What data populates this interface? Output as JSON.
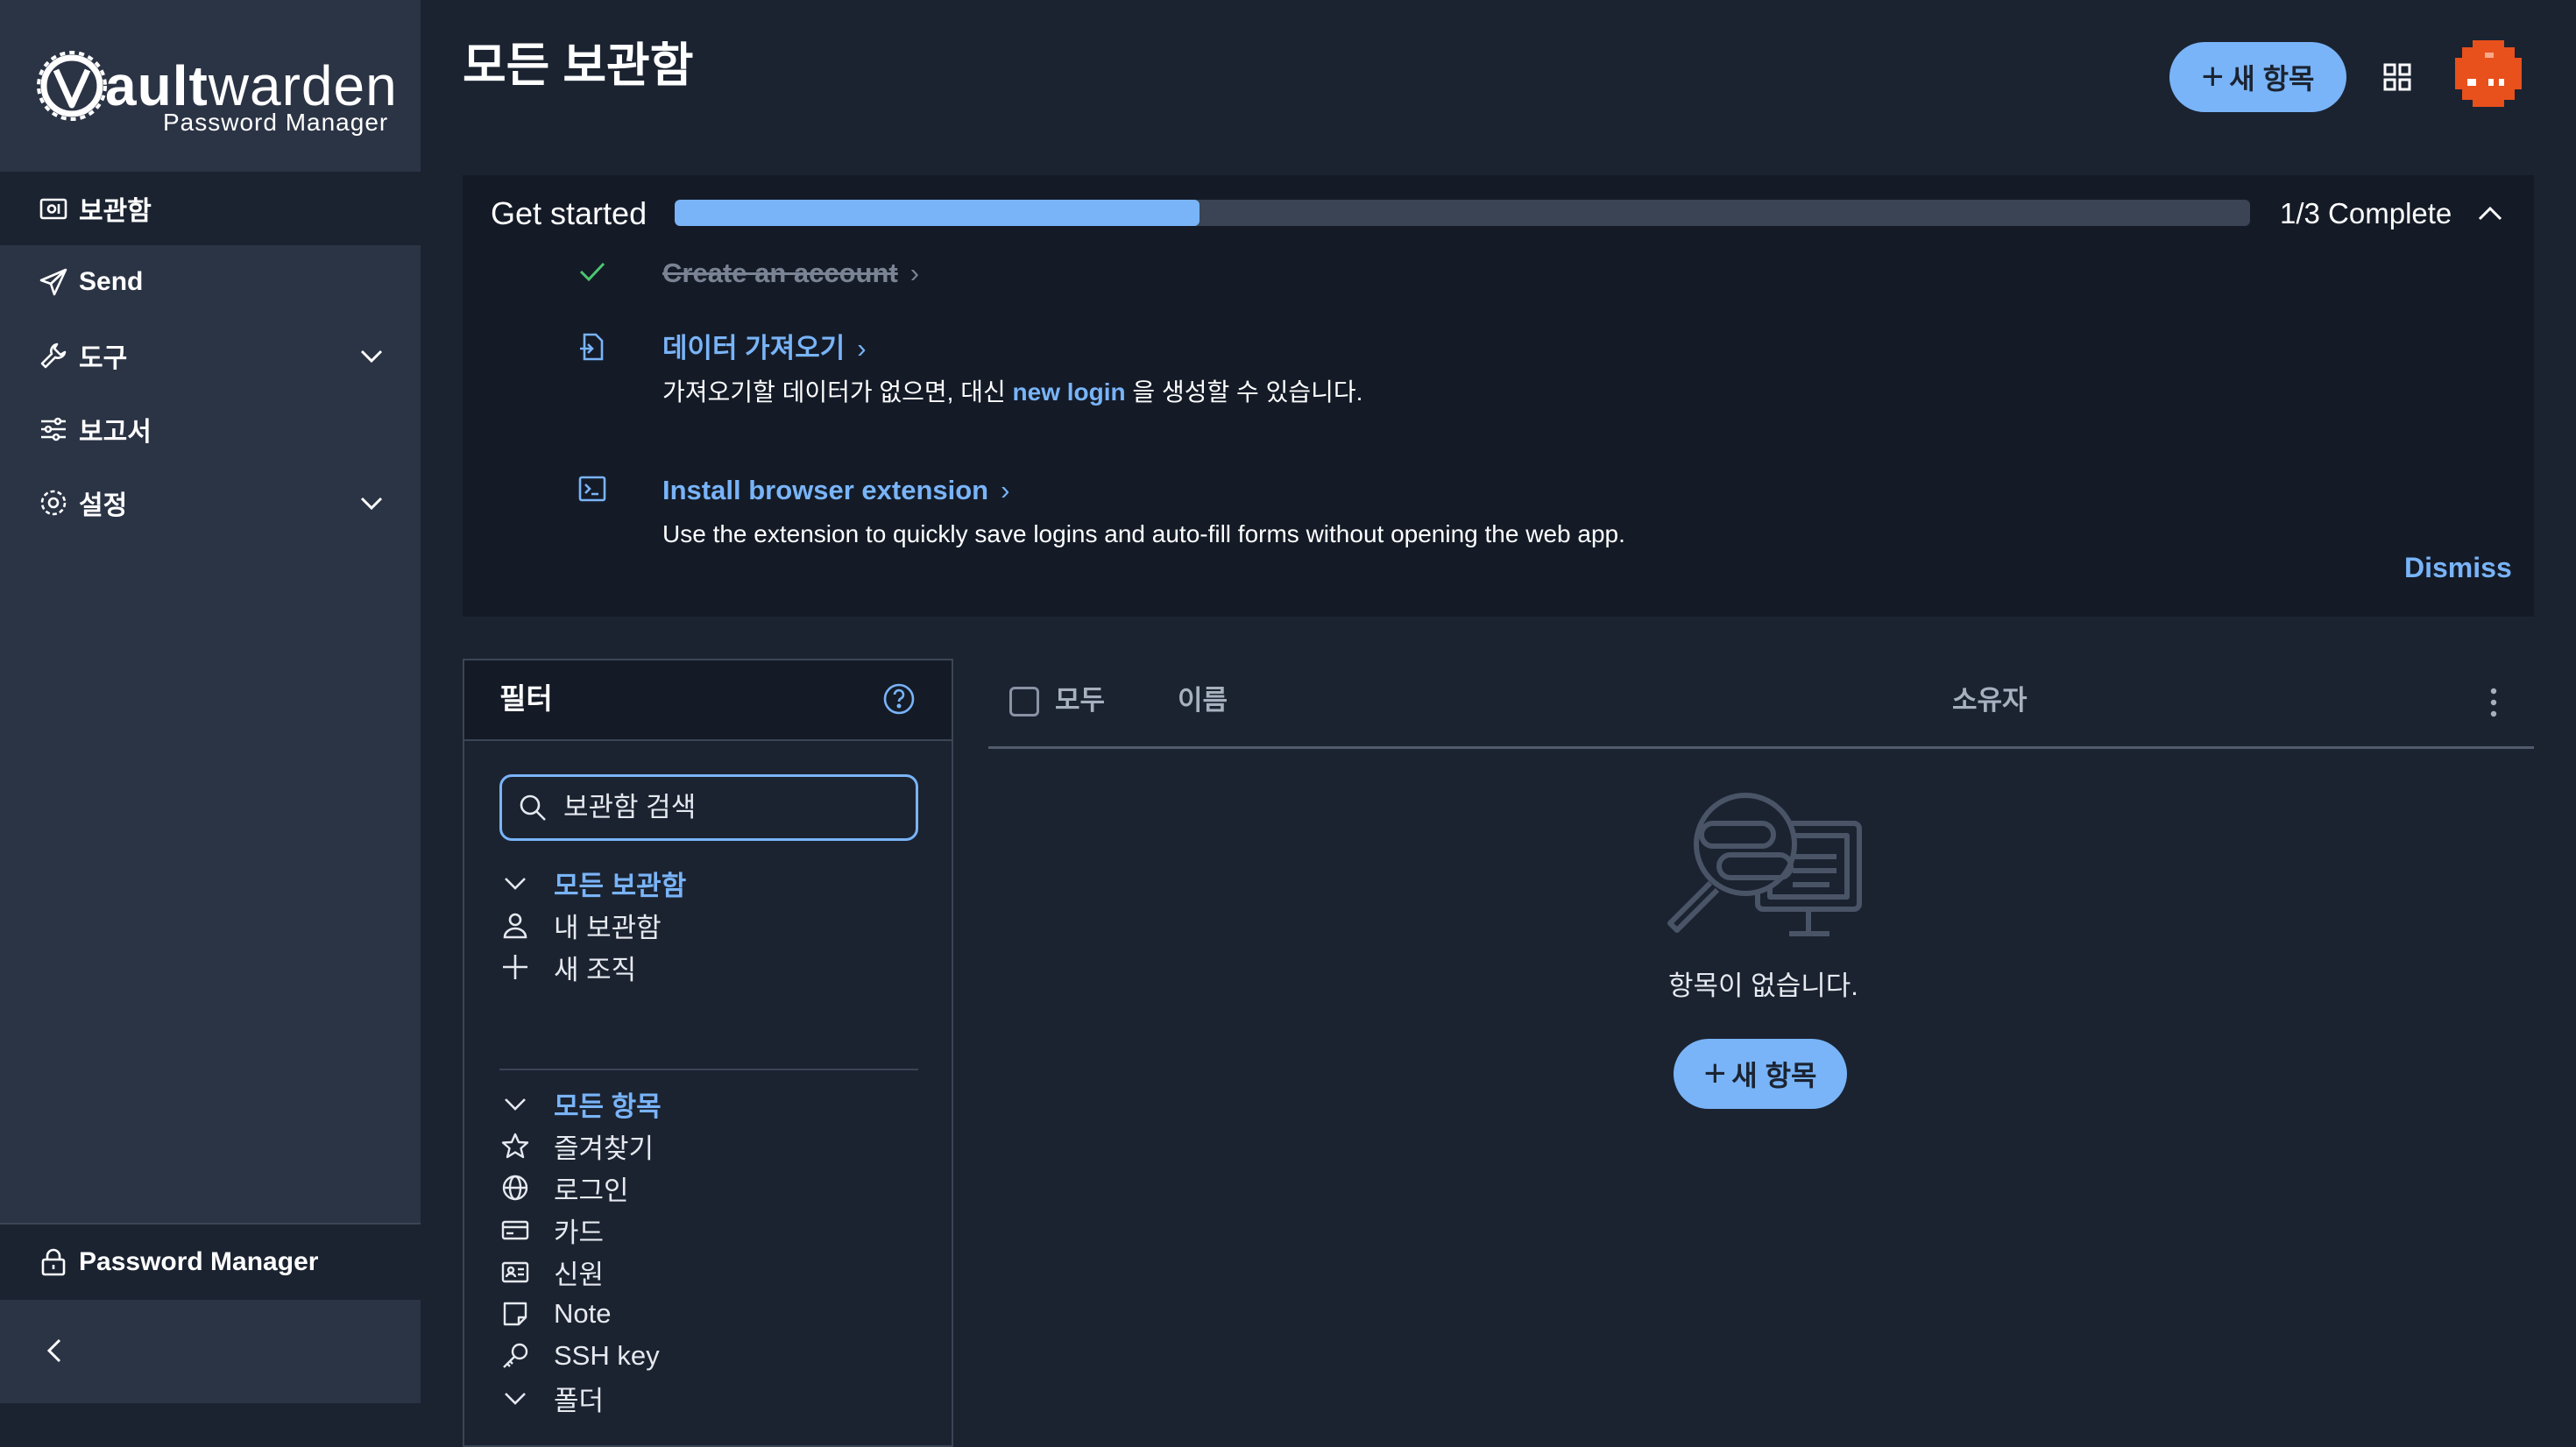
{
  "brand": {
    "name_bold": "V",
    "name_main": "ault",
    "name_light": "warden",
    "subtitle": "Password Manager"
  },
  "sidebar": {
    "items": [
      {
        "label": "보관함",
        "icon": "vault-icon",
        "active": true
      },
      {
        "label": "Send",
        "icon": "send-icon"
      },
      {
        "label": "도구",
        "icon": "wrench-icon",
        "expandable": true
      },
      {
        "label": "보고서",
        "icon": "sliders-icon"
      },
      {
        "label": "설정",
        "icon": "gear-icon",
        "expandable": true
      }
    ],
    "product_switcher": "Password Manager",
    "collapse_icon": "chevron-left-icon"
  },
  "header": {
    "title": "모든 보관함",
    "new_item": "새 항목",
    "apps_icon": "grid-icon"
  },
  "get_started": {
    "title": "Get started",
    "progress": 0.333,
    "progress_text": "1/3 Complete",
    "tasks": [
      {
        "label": "Create an account",
        "done": true
      },
      {
        "label": "데이터 가져오기",
        "desc_pre": "가져오기할 데이터가 없으면, 대신 ",
        "desc_link": "new login",
        "desc_post": " 을 생성할 수 있습니다."
      },
      {
        "label": "Install browser extension",
        "desc": "Use the extension to quickly save logins and auto-fill forms without opening the web app."
      }
    ],
    "dismiss": "Dismiss"
  },
  "filter": {
    "title": "필터",
    "search_placeholder": "보관함 검색",
    "vaults_head": "모든 보관함",
    "my_vault": "내 보관함",
    "new_org": "새 조직",
    "types_head": "모든 항목",
    "types": [
      "즐겨찾기",
      "로그인",
      "카드",
      "신원",
      "Note",
      "SSH key"
    ],
    "folders_head": "폴더"
  },
  "table": {
    "select_all": "모두",
    "col_name": "이름",
    "col_owner": "소유자",
    "empty_text": "항목이 없습니다.",
    "new_item": "새 항목"
  },
  "colors": {
    "accent": "#79b4f8",
    "sidebar": "#2b3445",
    "background": "#1b2331",
    "panel": "#141b27",
    "avatar": "#e8501c"
  }
}
